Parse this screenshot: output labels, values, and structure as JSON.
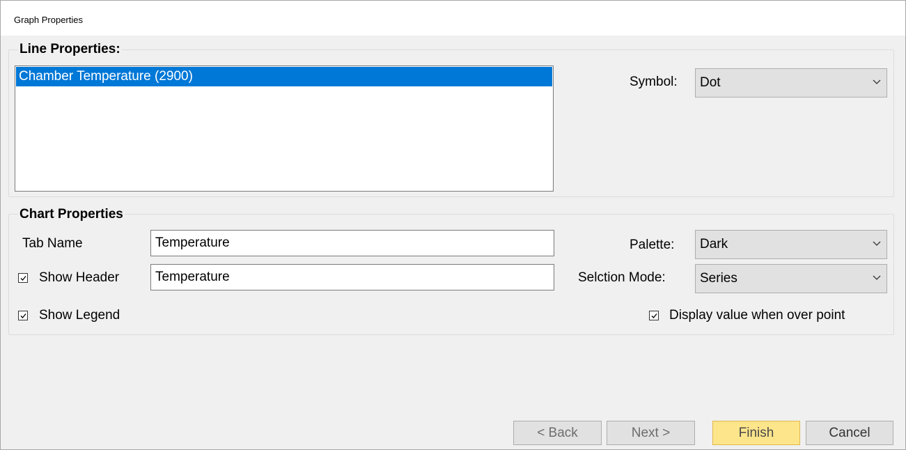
{
  "window": {
    "title": "Graph Properties"
  },
  "line_properties": {
    "label": "Line Properties:",
    "items": [
      "Chamber Temperature (2900)"
    ],
    "symbol_label": "Symbol:",
    "symbol_value": "Dot"
  },
  "chart_properties": {
    "label": "Chart Properties",
    "tab_name_label": "Tab Name",
    "tab_name_value": "Temperature",
    "show_header_label": "Show Header",
    "show_header_checked": true,
    "header_value": "Temperature",
    "show_legend_label": "Show Legend",
    "show_legend_checked": true,
    "palette_label": "Palette:",
    "palette_value": "Dark",
    "selection_mode_label": "Selction Mode:",
    "selection_mode_value": "Series",
    "display_value_label": "Display value when over point",
    "display_value_checked": true
  },
  "buttons": {
    "back": "< Back",
    "next": "Next >",
    "finish": "Finish",
    "cancel": "Cancel"
  },
  "colors": {
    "selection": "#0078d7",
    "finish_button": "#fde58b",
    "dialog_background": "#f0f0f0"
  }
}
